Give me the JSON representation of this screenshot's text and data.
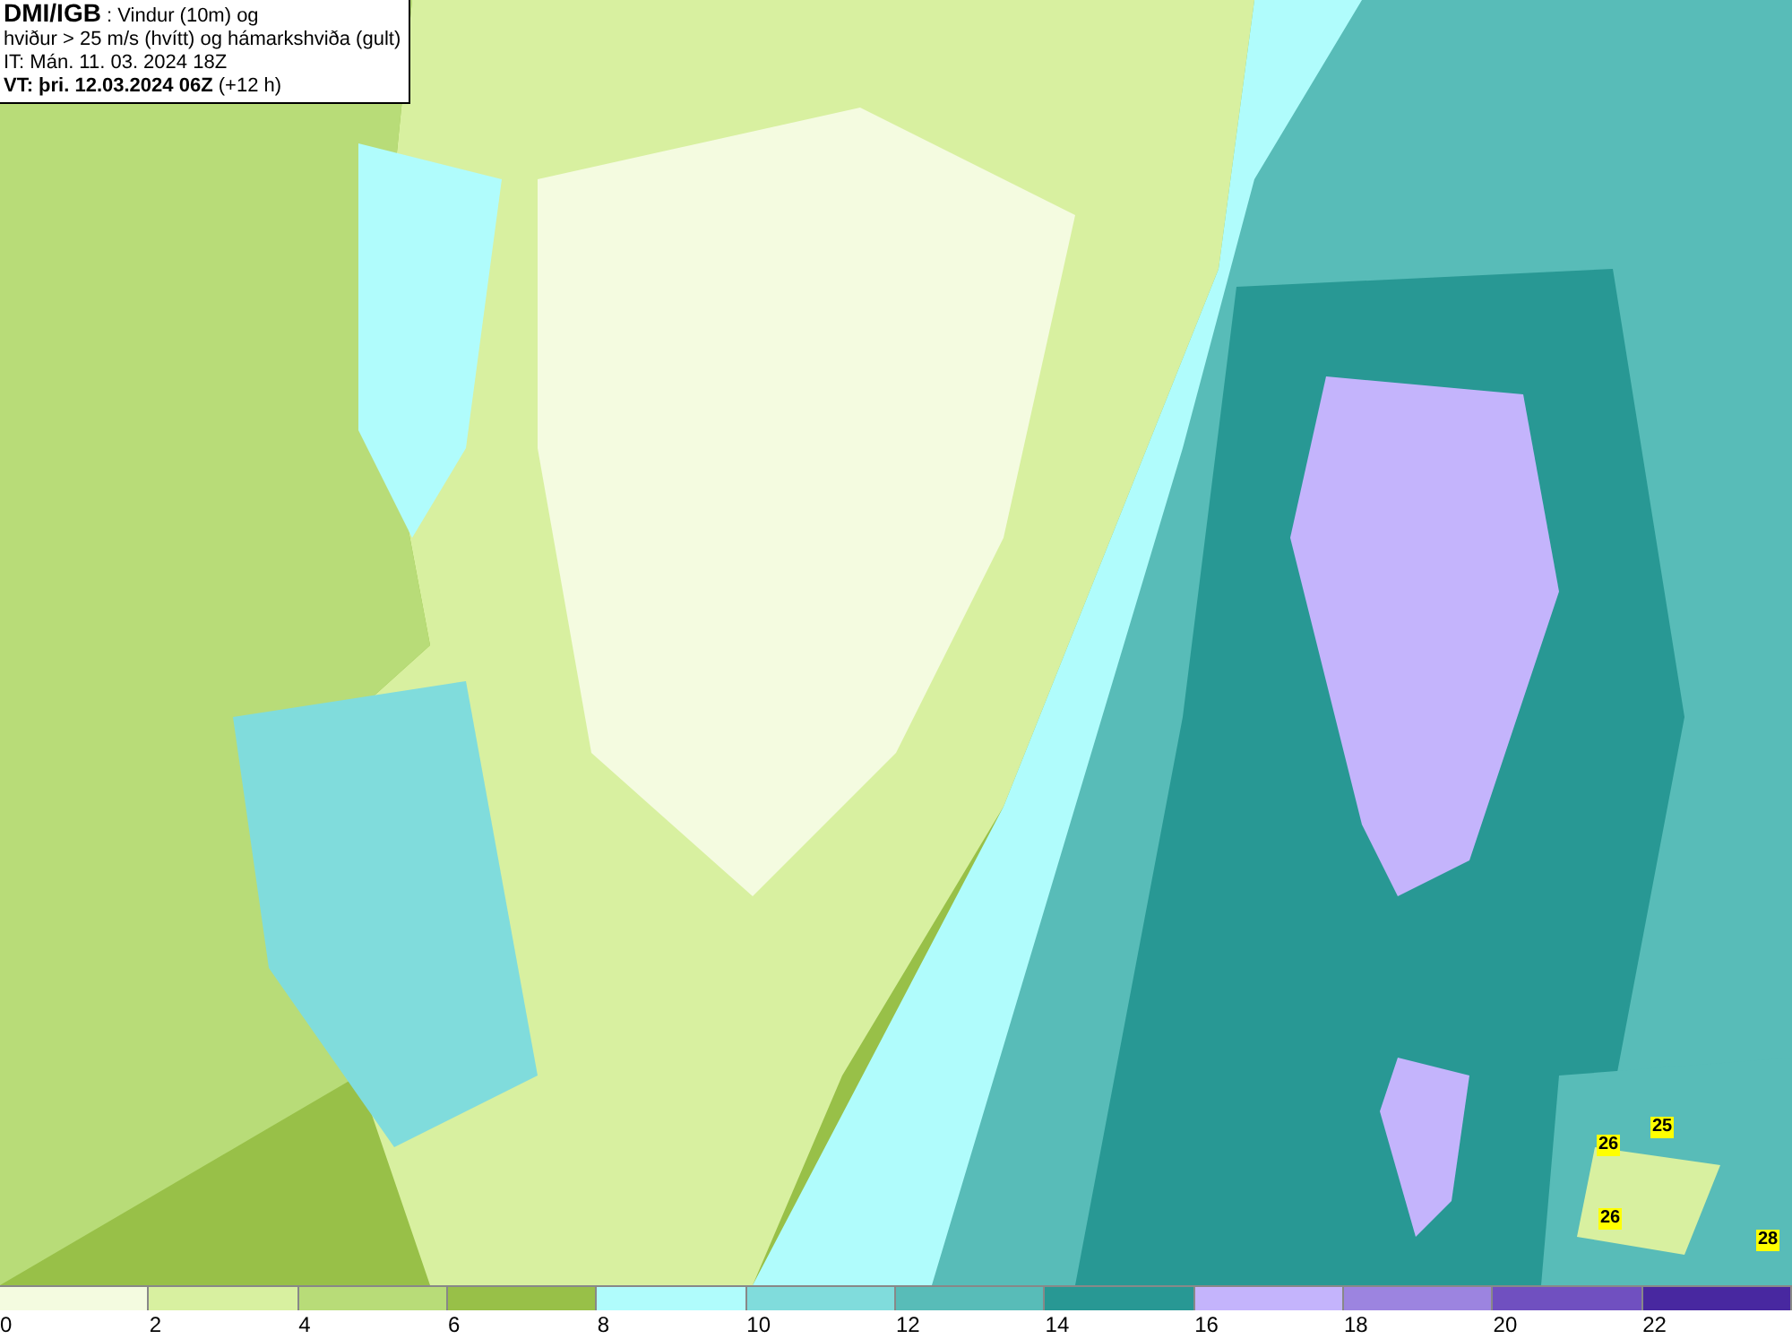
{
  "title_box": {
    "source": "DMI/IGB",
    "title_rest": ": Vindur (10m) og",
    "line_2": "hviður > 25 m/s (hvítt) og hámarkshviða (gult)",
    "issue_time": "IT: Mán. 11. 03. 2024 18Z",
    "valid_label": "VT: þri. 12.03.2024 06Z",
    "valid_offset": "(+12 h)"
  },
  "map": {
    "gust_labels": [
      "26",
      "25",
      "26",
      "28"
    ]
  },
  "color_scale": [
    {
      "color": "#f4fbe0",
      "label": "0"
    },
    {
      "color": "#d8f0a0",
      "label": "2"
    },
    {
      "color": "#b8dc78",
      "label": "4"
    },
    {
      "color": "#98c048",
      "label": "6"
    },
    {
      "color": "#b0fcfc",
      "label": "8"
    },
    {
      "color": "#80dcdc",
      "label": "10"
    },
    {
      "color": "#58bcb8",
      "label": "12"
    },
    {
      "color": "#289894",
      "label": "14"
    },
    {
      "color": "#c4b4fc",
      "label": "16"
    },
    {
      "color": "#9c84e0",
      "label": "18"
    },
    {
      "color": "#7050c0",
      "label": "20"
    },
    {
      "color": "#4828a0",
      "label": "22"
    }
  ]
}
